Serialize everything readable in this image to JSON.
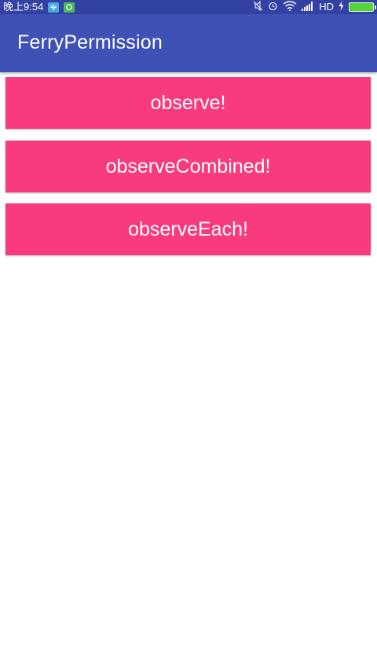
{
  "status_bar": {
    "time": "晚上9:54",
    "network": "HD"
  },
  "app_bar": {
    "title": "FerryPermission"
  },
  "buttons": {
    "observe": "observe!",
    "observe_combined": "observeCombined!",
    "observe_each": "observeEach!"
  },
  "colors": {
    "status_bar": "#3341a3",
    "app_bar": "#3f51b5",
    "button": "#f93a7e",
    "button_text": "#ffffff",
    "background": "#ffffff"
  }
}
